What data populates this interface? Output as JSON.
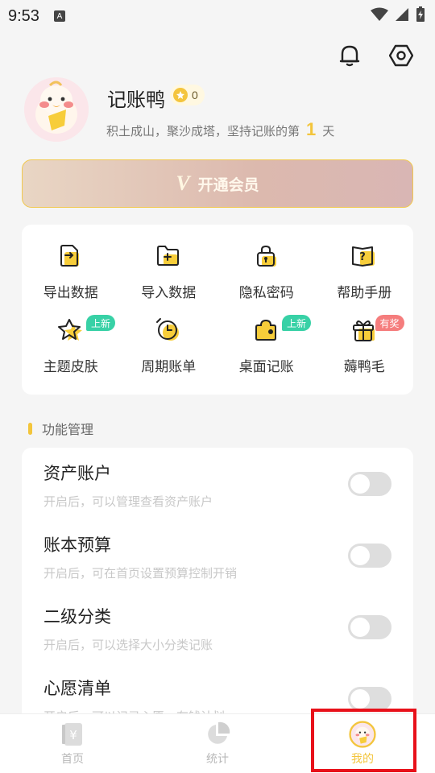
{
  "status_bar": {
    "time": "9:53",
    "notification_letter": "A"
  },
  "profile": {
    "username": "记账鸭",
    "coins": "0",
    "motto_prefix": "积土成山，聚沙成塔，坚持记账的第",
    "days": "1",
    "motto_suffix": "天"
  },
  "vip": {
    "label": "开通会员"
  },
  "grid": [
    {
      "label": "导出数据",
      "icon": "export-file-icon",
      "tag": ""
    },
    {
      "label": "导入数据",
      "icon": "import-folder-icon",
      "tag": ""
    },
    {
      "label": "隐私密码",
      "icon": "lock-icon",
      "tag": ""
    },
    {
      "label": "帮助手册",
      "icon": "help-book-icon",
      "tag": ""
    },
    {
      "label": "主题皮肤",
      "icon": "star-icon",
      "tag": "上新"
    },
    {
      "label": "周期账单",
      "icon": "clock-icon",
      "tag": ""
    },
    {
      "label": "桌面记账",
      "icon": "widget-icon",
      "tag": "上新"
    },
    {
      "label": "薅鸭毛",
      "icon": "gift-icon",
      "tag": "有奖"
    }
  ],
  "section": {
    "title": "功能管理"
  },
  "features": [
    {
      "title": "资产账户",
      "desc": "开启后，可以管理查看资产账户",
      "enabled": false
    },
    {
      "title": "账本预算",
      "desc": "开启后，可在首页设置预算控制开销",
      "enabled": false
    },
    {
      "title": "二级分类",
      "desc": "开启后，可以选择大小分类记账",
      "enabled": false
    },
    {
      "title": "心愿清单",
      "desc": "开启后，可以记录心愿，存钱计划",
      "enabled": false
    }
  ],
  "bottom_nav": [
    {
      "label": "首页",
      "icon": "home-ledger-icon",
      "active": false
    },
    {
      "label": "统计",
      "icon": "pie-chart-icon",
      "active": false
    },
    {
      "label": "我的",
      "icon": "duck-avatar-icon",
      "active": true
    }
  ],
  "colors": {
    "accent": "#f3c53c",
    "new_tag": "#38d1a6",
    "prize_tag": "#f57d7d",
    "highlight": "#e8111a"
  }
}
